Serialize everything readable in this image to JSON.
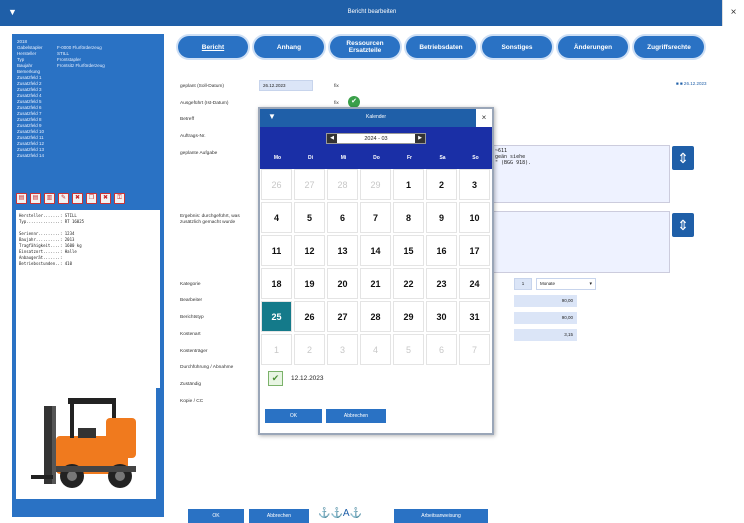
{
  "window": {
    "title": "Bericht bearbeiten",
    "menu_glyph": "▼",
    "close_glyph": "×"
  },
  "sidebar": {
    "info": [
      {
        "k": "2018",
        "v": ""
      },
      {
        "k": "Gabelstapler",
        "v": "F-0000 Flurförderzeug"
      },
      {
        "k": "Hersteller",
        "v": "STILL"
      },
      {
        "k": "Typ",
        "v": "Frontstapler"
      },
      {
        "k": "Baujahr",
        "v": "Frontsitz Flurförderzeug"
      },
      {
        "k": "Bemerkung",
        "v": ""
      },
      {
        "k": "Zusatzfeld 1",
        "v": ""
      },
      {
        "k": "Zusatzfeld 2",
        "v": ""
      },
      {
        "k": "Zusatzfeld 3",
        "v": ""
      },
      {
        "k": "Zusatzfeld 4",
        "v": ""
      },
      {
        "k": "Zusatzfeld 5",
        "v": ""
      },
      {
        "k": "Zusatzfeld 6",
        "v": ""
      },
      {
        "k": "Zusatzfeld 7",
        "v": ""
      },
      {
        "k": "Zusatzfeld 8",
        "v": ""
      },
      {
        "k": "Zusatzfeld 9",
        "v": ""
      },
      {
        "k": "Zusatzfeld 10",
        "v": ""
      },
      {
        "k": "Zusatzfeld 11",
        "v": ""
      },
      {
        "k": "Zusatzfeld 12",
        "v": ""
      },
      {
        "k": "Zusatzfeld 13",
        "v": ""
      },
      {
        "k": "Zusatzfeld 14",
        "v": ""
      }
    ],
    "details": "Hersteller.......: STILL\nTyp..............: RT 16025\n\nSeriennr.........: 1234\nBaujahr..........: 2013\nTragfähigkeit....: 1600 kg\nEinsatzort.......: Halle\nAnbaugerät.......: \nBetriebsstunden..: 410\n"
  },
  "tabs": [
    {
      "label": "Bericht",
      "w": 70
    },
    {
      "label": "Anhang",
      "w": 70
    },
    {
      "label": "Ressourcen Ersatzteile",
      "w": 70
    },
    {
      "label": "Betriebsdaten",
      "w": 70
    },
    {
      "label": "Sonstiges",
      "w": 70
    },
    {
      "label": "Änderungen",
      "w": 70
    },
    {
      "label": "Zugriffsrechte",
      "w": 70
    }
  ],
  "form": {
    "geplant_label": "geplant (Soll-Datum)",
    "geplant_value": "26.12.2023",
    "geplant_unit": "fix",
    "ausgefuehrt_label": "Ausgeführt (Ist-Datum)",
    "ausgefuehrt_unit": "fix",
    "betreff_label": "Betreff",
    "auftrag_label": "Auftrags-Nr.",
    "aufgabe_label": "geplante Aufgabe",
    "aufgabe_text": "~611\ngeän siehe\n\" (BGG 918).",
    "ergebnis_label": "Ergebnis: durchgeführt, was zusätzlich gemacht wurde",
    "kategorie_label": "Kategorie",
    "bearbeiter_label": "Bearbeiter",
    "berichtstyp_label": "Berichtstyp",
    "kostenart_label": "Kostenart",
    "kostentraeger_label": "Kostenträger",
    "durchfuehrung_label": "Durchführung / Abnahme",
    "zustaendig_label": "Zuständig",
    "kopie_label": "Kopie / CC",
    "intervall_value": "1",
    "intervall_unit": "Monate",
    "right_values": [
      "90,00",
      "90,00",
      "3,15"
    ],
    "link_date": "■ ■ 26.12.2023",
    "check_glyph": "✔"
  },
  "calendar": {
    "title": "Kalender",
    "month": "2024 - 03",
    "prev": "◀",
    "next": "▶",
    "weekdays": [
      "Mo",
      "Di",
      "Mi",
      "Do",
      "Fr",
      "Sa",
      "So"
    ],
    "days": [
      [
        "26",
        "27",
        "28",
        "29",
        "1",
        "2",
        "3"
      ],
      [
        "4",
        "5",
        "6",
        "7",
        "8",
        "9",
        "10"
      ],
      [
        "11",
        "12",
        "13",
        "14",
        "15",
        "16",
        "17"
      ],
      [
        "18",
        "19",
        "20",
        "21",
        "22",
        "23",
        "24"
      ],
      [
        "25",
        "26",
        "27",
        "28",
        "29",
        "30",
        "31"
      ],
      [
        "1",
        "2",
        "3",
        "4",
        "5",
        "6",
        "7"
      ]
    ],
    "out_first_row": 4,
    "selected": "25",
    "today_label": "12.12.2023",
    "ok": "OK",
    "cancel": "Abbrechen"
  },
  "bottom": {
    "ok": "OK",
    "cancel": "Abbrechen",
    "icons": "⚓⚓Α⚓",
    "history": "Arbeitsanweisung"
  }
}
